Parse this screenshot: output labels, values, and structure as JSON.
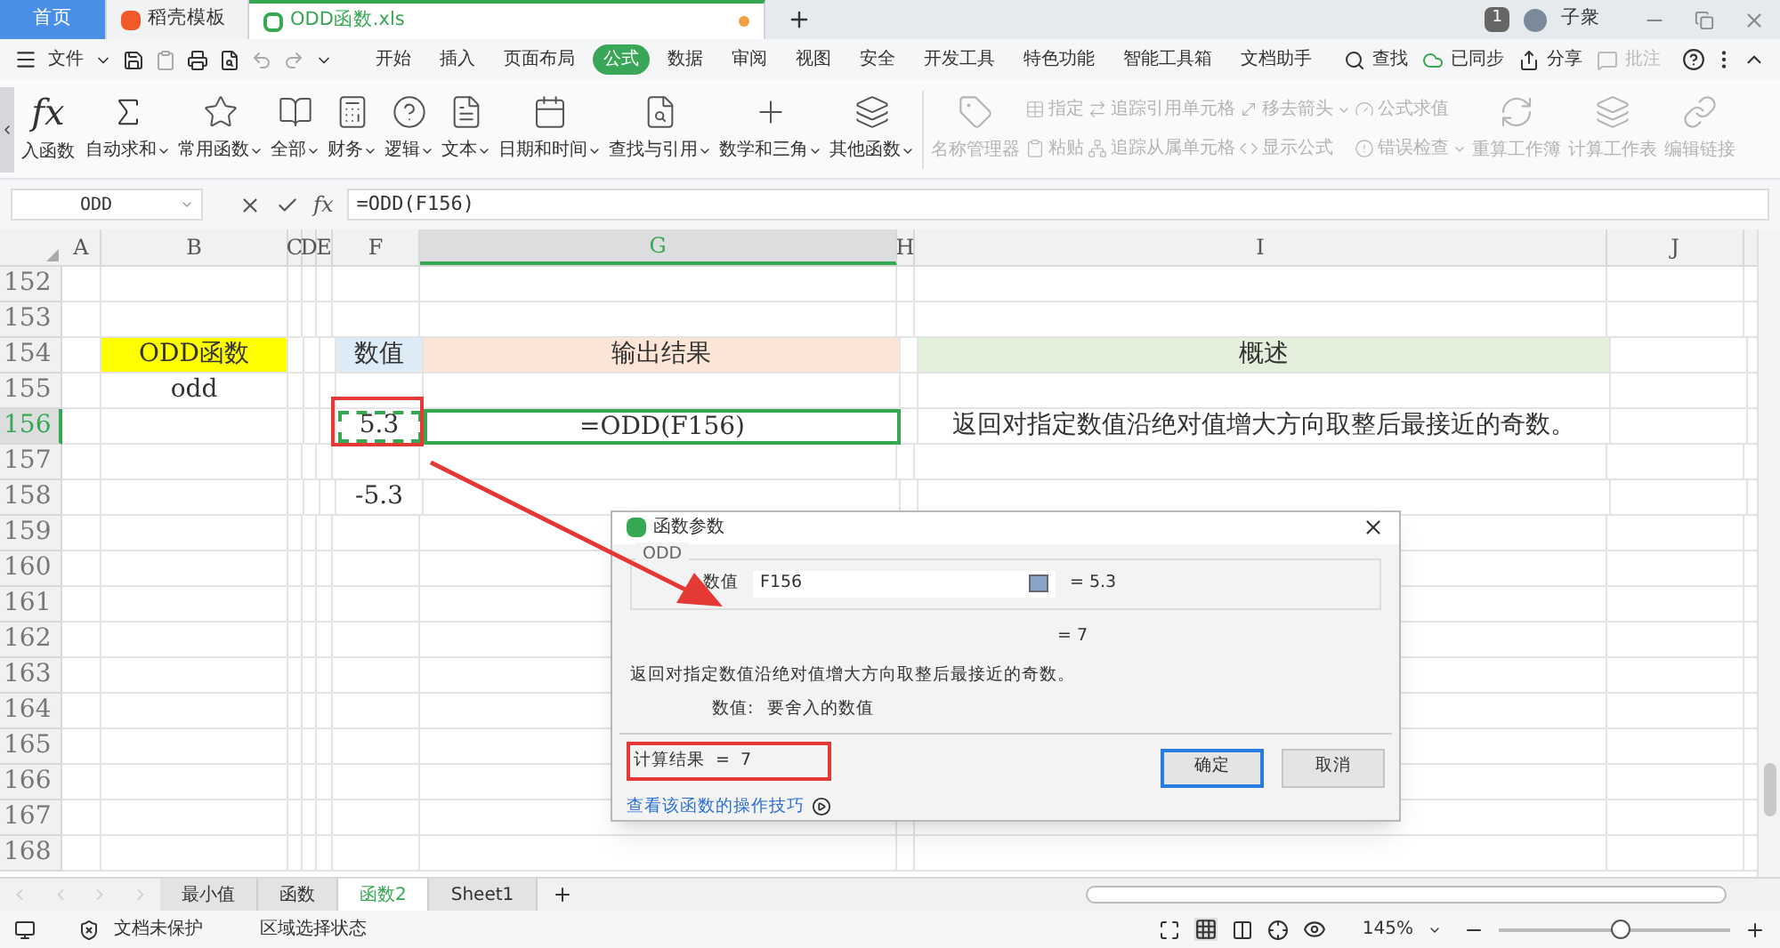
{
  "doc_tabs": [
    {
      "label": "首页",
      "kind": "home",
      "selected": false,
      "modified": false
    },
    {
      "label": "稻壳模板",
      "kind": "template",
      "selected": false,
      "modified": false
    },
    {
      "label": "ODD函数.xls",
      "kind": "sheet",
      "selected": true,
      "modified": true
    }
  ],
  "account": {
    "badge": "1",
    "name": "子衆"
  },
  "menu": {
    "file": "文件",
    "tabs": [
      {
        "label": "开始",
        "selected": false
      },
      {
        "label": "插入",
        "selected": false
      },
      {
        "label": "页面布局",
        "selected": false
      },
      {
        "label": "公式",
        "selected": true
      },
      {
        "label": "数据",
        "selected": false
      },
      {
        "label": "审阅",
        "selected": false
      },
      {
        "label": "视图",
        "selected": false
      },
      {
        "label": "安全",
        "selected": false
      },
      {
        "label": "开发工具",
        "selected": false
      },
      {
        "label": "特色功能",
        "selected": false
      },
      {
        "label": "智能工具箱",
        "selected": false
      },
      {
        "label": "文档助手",
        "selected": false
      }
    ],
    "search": "查找",
    "sync": "已同步",
    "share": "分享",
    "comment": "批注"
  },
  "ribbon": {
    "insert": {
      "glyph": "fx",
      "label": "入函数"
    },
    "functions": [
      {
        "label": "自动求和",
        "disabled": false
      },
      {
        "label": "常用函数",
        "disabled": false
      },
      {
        "label": "全部",
        "disabled": false
      },
      {
        "label": "财务",
        "disabled": false
      },
      {
        "label": "逻辑",
        "disabled": false
      },
      {
        "label": "文本",
        "disabled": false
      },
      {
        "label": "日期和时间",
        "disabled": false
      },
      {
        "label": "查找与引用",
        "disabled": false
      },
      {
        "label": "数学和三角",
        "disabled": false
      },
      {
        "label": "其他函数",
        "disabled": false
      }
    ],
    "tools": [
      {
        "label": "名称管理器",
        "kind": "large",
        "dropdown": false,
        "disabled": true
      },
      {
        "label": "指定",
        "kind": "small",
        "dropdown": false,
        "disabled": true
      },
      {
        "label": "粘贴",
        "kind": "small",
        "dropdown": false,
        "disabled": true
      },
      {
        "label": "追踪引用单元格",
        "kind": "small",
        "dropdown": false,
        "disabled": true
      },
      {
        "label": "追踪从属单元格",
        "kind": "small",
        "dropdown": false,
        "disabled": true
      },
      {
        "label": "移去箭头",
        "kind": "small",
        "dropdown": true,
        "disabled": true
      },
      {
        "label": "显示公式",
        "kind": "small",
        "dropdown": false,
        "disabled": true
      },
      {
        "label": "公式求值",
        "kind": "small",
        "dropdown": false,
        "disabled": true
      },
      {
        "label": "错误检查",
        "kind": "small",
        "dropdown": true,
        "disabled": true
      },
      {
        "label": "重算工作簿",
        "kind": "large",
        "dropdown": false,
        "disabled": true
      },
      {
        "label": "计算工作表",
        "kind": "large",
        "dropdown": false,
        "disabled": true
      },
      {
        "label": "编辑链接",
        "kind": "large",
        "dropdown": false,
        "disabled": true
      }
    ]
  },
  "formula_bar": {
    "name_box": "ODD",
    "glyph": "fx",
    "formula": "=ODD(F156)"
  },
  "columns": [
    {
      "label": "A",
      "selected": false
    },
    {
      "label": "B",
      "selected": false
    },
    {
      "label": "C",
      "selected": false
    },
    {
      "label": "D",
      "selected": false
    },
    {
      "label": "E",
      "selected": false
    },
    {
      "label": "F",
      "selected": false
    },
    {
      "label": "G",
      "selected": true
    },
    {
      "label": "H",
      "selected": false
    },
    {
      "label": "I",
      "selected": false
    },
    {
      "label": "J",
      "selected": false
    }
  ],
  "rows": [
    {
      "number": "152",
      "selected": false,
      "cells": []
    },
    {
      "number": "153",
      "selected": false,
      "cells": []
    },
    {
      "number": "154",
      "selected": false,
      "cells": [
        {
          "selected": false,
          "copy_marquee": false
        },
        {
          "text": "ODD函数",
          "color": "#ffff00",
          "selected": false,
          "copy_marquee": false
        },
        {
          "selected": false,
          "copy_marquee": false
        },
        {
          "selected": false,
          "copy_marquee": false
        },
        {
          "selected": false,
          "copy_marquee": false
        },
        {
          "text": "数值",
          "color": "#ddebf7",
          "selected": false,
          "copy_marquee": false
        },
        {
          "text": "输出结果",
          "color": "#fce4d6",
          "selected": false,
          "copy_marquee": false
        },
        {
          "selected": false,
          "copy_marquee": false
        },
        {
          "text": "概述",
          "color": "#e2efda",
          "selected": false,
          "copy_marquee": false
        },
        {
          "selected": false,
          "copy_marquee": false
        }
      ]
    },
    {
      "number": "155",
      "selected": false,
      "cells": [
        {
          "selected": false,
          "copy_marquee": false
        },
        {
          "text": "odd",
          "selected": false,
          "copy_marquee": false
        },
        {
          "selected": false,
          "copy_marquee": false
        },
        {
          "selected": false,
          "copy_marquee": false
        },
        {
          "selected": false,
          "copy_marquee": false
        },
        {
          "selected": false,
          "copy_marquee": false
        },
        {
          "selected": false,
          "copy_marquee": false
        },
        {
          "selected": false,
          "copy_marquee": false
        },
        {
          "selected": false,
          "copy_marquee": false
        },
        {
          "selected": false,
          "copy_marquee": false
        }
      ]
    },
    {
      "number": "156",
      "selected": true,
      "cells": [
        {
          "selected": false,
          "copy_marquee": false
        },
        {
          "selected": false,
          "copy_marquee": false
        },
        {
          "selected": false,
          "copy_marquee": false
        },
        {
          "selected": false,
          "copy_marquee": false
        },
        {
          "selected": false,
          "copy_marquee": false
        },
        {
          "text": "5.3",
          "selected": false,
          "copy_marquee": true
        },
        {
          "text": "=ODD(F156)",
          "selected": true,
          "copy_marquee": false
        },
        {
          "selected": false,
          "copy_marquee": false
        },
        {
          "text": "返回对指定数值沿绝对值增大方向取整后最接近的奇数。",
          "selected": false,
          "copy_marquee": false
        },
        {
          "selected": false,
          "copy_marquee": false
        }
      ]
    },
    {
      "number": "157",
      "selected": false,
      "cells": []
    },
    {
      "number": "158",
      "selected": false,
      "cells": [
        {
          "selected": false,
          "copy_marquee": false
        },
        {
          "selected": false,
          "copy_marquee": false
        },
        {
          "selected": false,
          "copy_marquee": false
        },
        {
          "selected": false,
          "copy_marquee": false
        },
        {
          "selected": false,
          "copy_marquee": false
        },
        {
          "text": "-5.3",
          "selected": false,
          "copy_marquee": false
        },
        {
          "selected": false,
          "copy_marquee": false
        },
        {
          "selected": false,
          "copy_marquee": false
        },
        {
          "selected": false,
          "copy_marquee": false
        },
        {
          "selected": false,
          "copy_marquee": false
        }
      ]
    },
    {
      "number": "159",
      "selected": false,
      "cells": []
    },
    {
      "number": "160",
      "selected": false,
      "cells": []
    },
    {
      "number": "161",
      "selected": false,
      "cells": []
    },
    {
      "number": "162",
      "selected": false,
      "cells": []
    },
    {
      "number": "163",
      "selected": false,
      "cells": []
    },
    {
      "number": "164",
      "selected": false,
      "cells": []
    },
    {
      "number": "165",
      "selected": false,
      "cells": []
    },
    {
      "number": "166",
      "selected": false,
      "cells": []
    },
    {
      "number": "167",
      "selected": false,
      "cells": []
    },
    {
      "number": "168",
      "selected": false,
      "cells": []
    }
  ],
  "dialog": {
    "title": "函数参数",
    "function": "ODD",
    "argument": {
      "label": "数值",
      "value": "F156",
      "result": "= 5.3"
    },
    "result": "= 7",
    "description": "返回对指定数值沿绝对值增大方向取整后最接近的奇数。",
    "argument_help": {
      "label": "数值:",
      "text": "要舍入的数值"
    },
    "computed": "计算结果  =  7",
    "link": "查看该函数的操作技巧",
    "buttons": [
      {
        "label": "确定",
        "default": true
      },
      {
        "label": "取消",
        "default": false
      }
    ]
  },
  "sheet_tabs": [
    {
      "label": "最小值",
      "selected": false
    },
    {
      "label": "函数",
      "selected": false
    },
    {
      "label": "函数2",
      "selected": true
    },
    {
      "label": "Sheet1",
      "selected": false
    }
  ],
  "status_bar": {
    "protection": "文档未保护",
    "selection_mode": "区域选择状态",
    "zoom": "145%",
    "zoom_level": {
      "level": 0.52
    }
  }
}
